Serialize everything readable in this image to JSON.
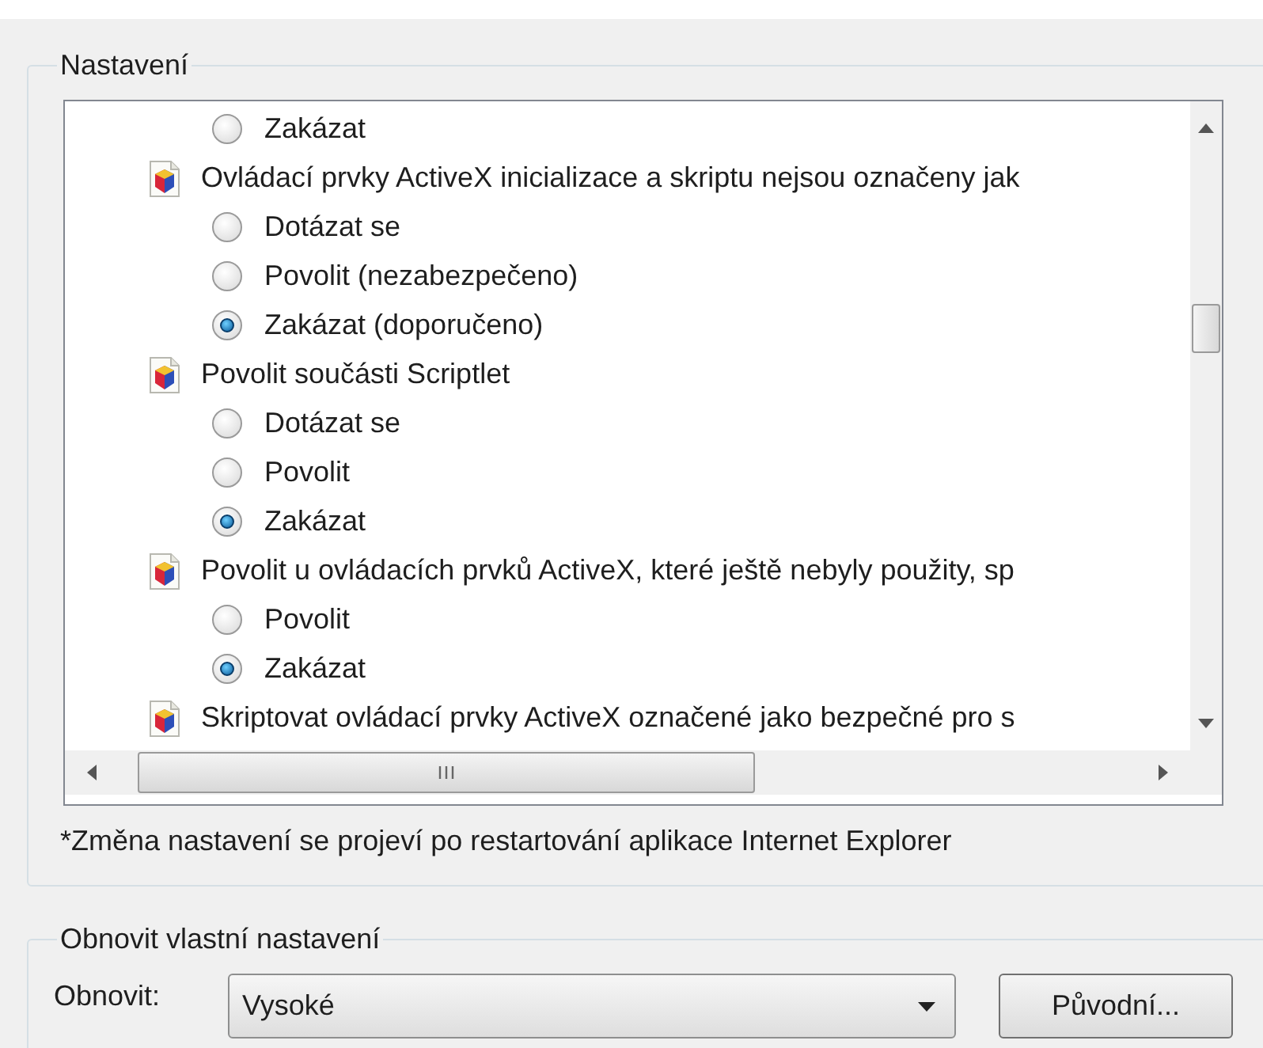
{
  "settings_group": {
    "title": "Nastavení",
    "items": [
      {
        "kind": "option",
        "label": "Zakázat",
        "selected": false
      },
      {
        "kind": "header",
        "label": "Ovládací prvky ActiveX inicializace a skriptu nejsou označeny jak"
      },
      {
        "kind": "option",
        "label": "Dotázat se",
        "selected": false
      },
      {
        "kind": "option",
        "label": "Povolit (nezabezpečeno)",
        "selected": false
      },
      {
        "kind": "option",
        "label": "Zakázat (doporučeno)",
        "selected": true
      },
      {
        "kind": "header",
        "label": "Povolit součásti Scriptlet"
      },
      {
        "kind": "option",
        "label": "Dotázat se",
        "selected": false
      },
      {
        "kind": "option",
        "label": "Povolit",
        "selected": false
      },
      {
        "kind": "option",
        "label": "Zakázat",
        "selected": true
      },
      {
        "kind": "header",
        "label": "Povolit u ovládacích prvků ActiveX, které ještě nebyly použity, sp"
      },
      {
        "kind": "option",
        "label": "Povolit",
        "selected": false
      },
      {
        "kind": "option",
        "label": "Zakázat",
        "selected": true
      },
      {
        "kind": "header",
        "label": "Skriptovat ovládací prvky ActiveX označené jako bezpečné pro s"
      }
    ],
    "note": "*Změna nastavení se projeví po restartování aplikace Internet Explorer"
  },
  "reset_group": {
    "title": "Obnovit vlastní nastavení",
    "label": "Obnovit:",
    "dropdown_value": "Vysoké",
    "button": "Původní..."
  }
}
